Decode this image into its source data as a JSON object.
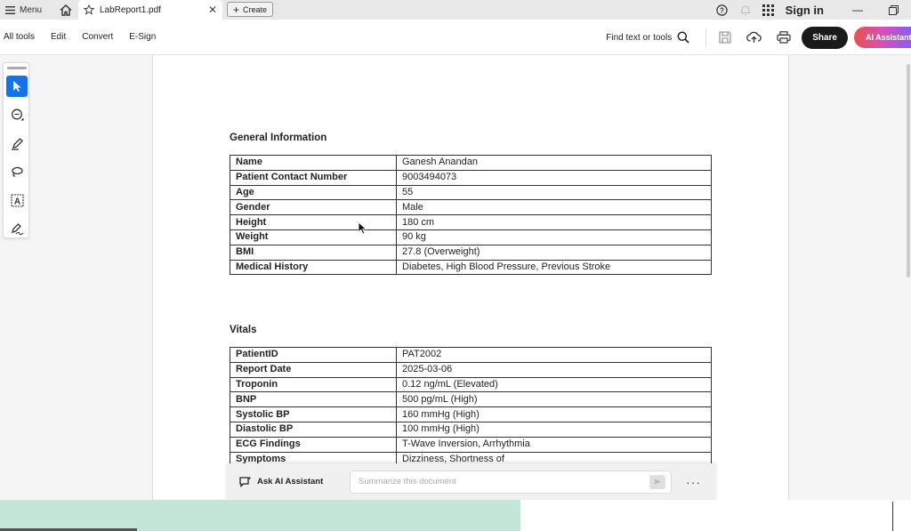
{
  "titlebar": {
    "menu_label": "Menu",
    "tab_title": "LabReport1.pdf",
    "create_label": "Create",
    "signin_label": "Sign in"
  },
  "toolbar": {
    "items": [
      "All tools",
      "Edit",
      "Convert",
      "E-Sign"
    ],
    "find_label": "Find text or tools",
    "share_label": "Share",
    "ai_label": "AI Assistant"
  },
  "document": {
    "general_title": "General Information",
    "general_rows": [
      {
        "key": "Name",
        "value": "Ganesh Anandan"
      },
      {
        "key": "Patient Contact Number",
        "value": "9003494073"
      },
      {
        "key": "Age",
        "value": "55"
      },
      {
        "key": "Gender",
        "value": "Male"
      },
      {
        "key": "Height",
        "value": "180 cm"
      },
      {
        "key": "Weight",
        "value": "90 kg"
      },
      {
        "key": "BMI",
        "value": "27.8 (Overweight)"
      },
      {
        "key": "Medical History",
        "value": "Diabetes, High Blood Pressure, Previous Stroke"
      }
    ],
    "vitals_title": "Vitals",
    "vitals_rows": [
      {
        "key": "PatientID",
        "value": "PAT2002"
      },
      {
        "key": "Report Date",
        "value": "2025-03-06"
      },
      {
        "key": "Troponin",
        "value": "0.12 ng/mL (Elevated)"
      },
      {
        "key": "BNP",
        "value": "500 pg/mL (High)"
      },
      {
        "key": "Systolic BP",
        "value": "160 mmHg (High)"
      },
      {
        "key": "Diastolic BP",
        "value": "100 mmHg (High)"
      },
      {
        "key": "ECG Findings",
        "value": "T-Wave Inversion, Arrhythmia"
      },
      {
        "key": "Symptoms",
        "value": "Dizziness, Shortness of"
      }
    ]
  },
  "ai_bar": {
    "label": "Ask AI Assistant",
    "placeholder": "Summarize this document"
  },
  "colors": {
    "accent": "#1473e6",
    "share_bg": "#1a1a1a",
    "footer_green": "#c4e6d8"
  }
}
